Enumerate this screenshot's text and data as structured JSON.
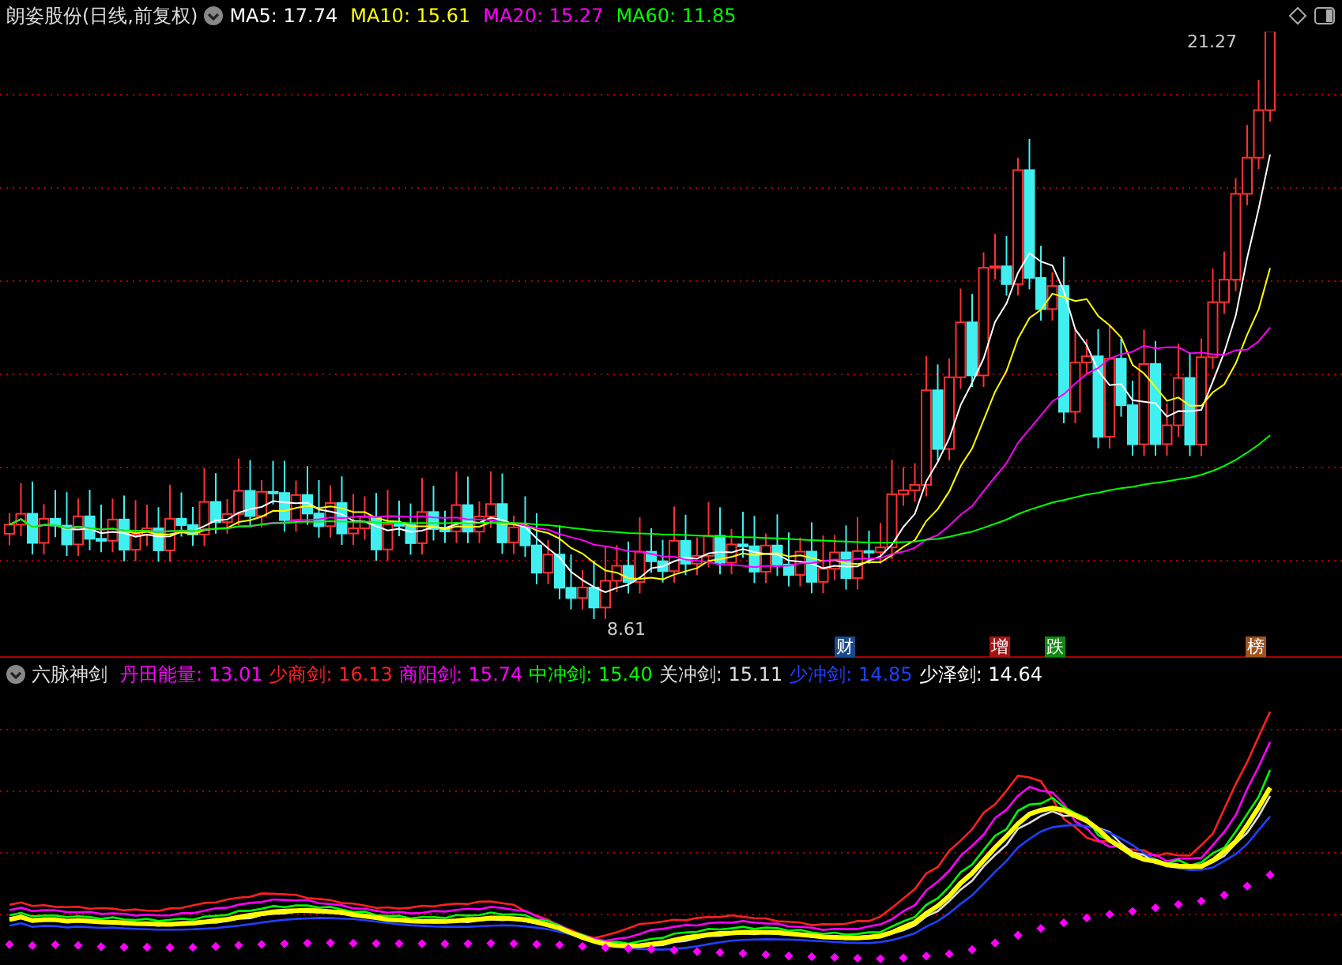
{
  "header": {
    "title": "朗姿股份(日线,前复权)",
    "ma_legend": [
      {
        "label": "MA5: 17.74",
        "color": "#ffffff"
      },
      {
        "label": "MA10: 15.61",
        "color": "#ffff00"
      },
      {
        "label": "MA20: 15.27",
        "color": "#ff00ff"
      },
      {
        "label": "MA60: 11.85",
        "color": "#00ff00"
      }
    ]
  },
  "main_chart": {
    "high_label": "21.27",
    "low_label": "8.61",
    "tags": [
      {
        "text": "财",
        "color": "#1a4a8a"
      },
      {
        "text": "增",
        "color": "#aa1111"
      },
      {
        "text": "跌",
        "color": "#118811"
      },
      {
        "text": "榜",
        "color": "#a0521a"
      }
    ]
  },
  "indicator": {
    "title": "六脉神剑",
    "legend": [
      {
        "label": "丹田能量: 13.01",
        "color": "#ff00ff"
      },
      {
        "label": "少商剑: 16.13",
        "color": "#ff2020"
      },
      {
        "label": "商阳剑: 15.74",
        "color": "#ff00ff"
      },
      {
        "label": "中冲剑: 15.40",
        "color": "#00ff00"
      },
      {
        "label": "关冲剑: 15.11",
        "color": "#dddddd"
      },
      {
        "label": "少冲剑: 14.85",
        "color": "#2040ff"
      },
      {
        "label": "少泽剑: 14.64",
        "color": "#ffffff"
      }
    ]
  }
}
